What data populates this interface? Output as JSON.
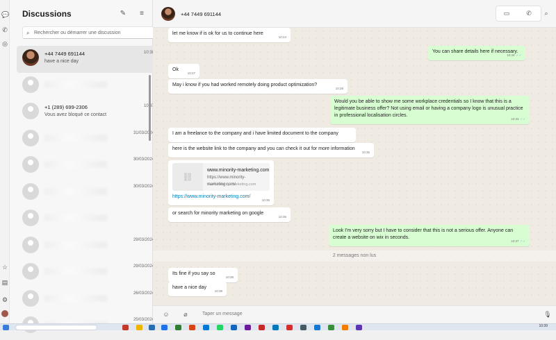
{
  "sidebar": {
    "title": "Discussions",
    "search_placeholder": "Rechercher ou démarrer une discussion",
    "chats": [
      {
        "name": "+44 7449 691144",
        "time": "10:38",
        "preview": "have a nice day",
        "active": true
      },
      {
        "name": "",
        "time": "",
        "preview": "",
        "blurred": true
      },
      {
        "name": "+1 (289) 699-2306",
        "time": "10:37",
        "preview": "Vous avez bloqué ce contact"
      },
      {
        "name": "",
        "time": "31/03/2024",
        "preview": "",
        "blurred": true
      },
      {
        "name": "",
        "time": "30/03/2024",
        "preview": "",
        "blurred": true
      },
      {
        "name": "",
        "time": "30/03/2024",
        "preview": "",
        "blurred": true
      },
      {
        "name": "",
        "time": "",
        "preview": "",
        "blurred": true
      },
      {
        "name": "",
        "time": "29/03/2024",
        "preview": "",
        "blurred": true
      },
      {
        "name": "",
        "time": "29/03/2024",
        "preview": "",
        "blurred": true
      },
      {
        "name": "",
        "time": "26/03/2024",
        "preview": "",
        "blurred": true
      },
      {
        "name": "",
        "time": "25/03/2024",
        "preview": "",
        "blurred": true
      }
    ]
  },
  "header": {
    "contact_name": "+44 7449 691144"
  },
  "messages": [
    {
      "dir": "in",
      "text": "let me know if is ok for us to continue here",
      "time": "10:24"
    },
    {
      "dir": "out",
      "text": "You can share details here if necessary.",
      "time": "10:26"
    },
    {
      "dir": "in",
      "text": "Ok",
      "time": "10:27"
    },
    {
      "dir": "in",
      "text": "May i know if you had worked remotely doing product optimization?",
      "time": "10:28"
    },
    {
      "dir": "out",
      "text": "Would you be able to show me some workplace credentials so I know that this is a legitimate business offer? Not using email or having a company logo is unusual practice in professional localisation circles.",
      "time": "10:33"
    },
    {
      "dir": "in",
      "text": "I am a freelance to the company and i have limited document to the company",
      "time": ""
    },
    {
      "dir": "in",
      "text": "here is the website link to the company and you can check it out for more information",
      "time": "10:35"
    },
    {
      "dir": "in",
      "link": {
        "title": "www.minority-marketing.com",
        "url": "https://www.minority-marketing.com/",
        "domain": "www.minority-marketing.com"
      },
      "text": "https://www.minority-marketing.com/",
      "time": "10:35"
    },
    {
      "dir": "in",
      "text": "or search for minority marketing on google",
      "time": "10:35"
    },
    {
      "dir": "out",
      "text": "Look I'm very sorry but I have to consider that this is not a serious offer. Anyone can create a website on wix in seconds.",
      "time": "10:37"
    },
    {
      "dir": "in",
      "text": "Its fine if you say so",
      "time": "10:38"
    },
    {
      "dir": "in",
      "text": "have a nice day",
      "time": "10:38"
    }
  ],
  "unread_label": "2 messages non lus",
  "composer": {
    "placeholder": "Taper un message"
  },
  "taskbar": {
    "time": "10:39"
  },
  "colors": {
    "outgoing_bubble": "#d9fdd3",
    "incoming_bubble": "#ffffff",
    "link": "#027eb5",
    "read_tick": "#53bdeb"
  }
}
